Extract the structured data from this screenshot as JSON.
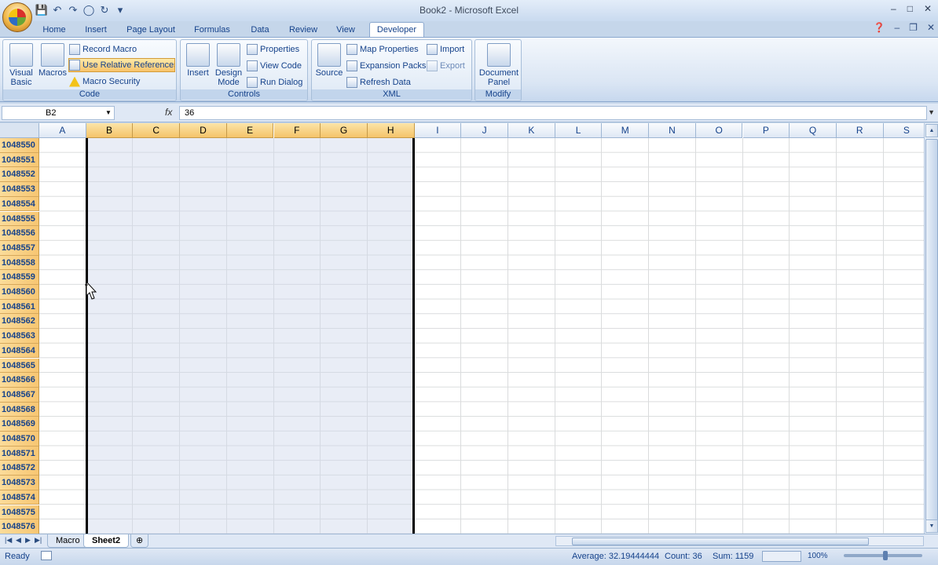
{
  "window": {
    "title": "Book2 - Microsoft Excel",
    "controls": [
      "–",
      "□",
      "✕"
    ]
  },
  "qat": {
    "icons": [
      "save-icon",
      "undo-icon",
      "redo-icon",
      "circle-icon",
      "loop-icon",
      "customize-icon"
    ]
  },
  "tabs": [
    {
      "label": "Home"
    },
    {
      "label": "Insert"
    },
    {
      "label": "Page Layout"
    },
    {
      "label": "Formulas"
    },
    {
      "label": "Data"
    },
    {
      "label": "Review"
    },
    {
      "label": "View"
    },
    {
      "label": "Developer"
    }
  ],
  "ribbon": {
    "code": {
      "label": "Code",
      "visual_basic": "Visual Basic",
      "macros": "Macros",
      "record_macro": "Record Macro",
      "use_relative": "Use Relative References",
      "macro_security": "Macro Security"
    },
    "controls": {
      "label": "Controls",
      "insert": "Insert",
      "design_mode": "Design Mode",
      "properties": "Properties",
      "view_code": "View Code",
      "run_dialog": "Run Dialog"
    },
    "xml": {
      "label": "XML",
      "source": "Source",
      "map_properties": "Map Properties",
      "expansion_packs": "Expansion Packs",
      "refresh_data": "Refresh Data",
      "import": "Import",
      "export": "Export"
    },
    "modify": {
      "label": "Modify",
      "document_panel": "Document Panel"
    }
  },
  "formula_bar": {
    "name_box": "B2",
    "fx": "fx",
    "value": "36"
  },
  "columns": [
    "A",
    "B",
    "C",
    "D",
    "E",
    "F",
    "G",
    "H",
    "I",
    "J",
    "K",
    "L",
    "M",
    "N",
    "O",
    "P",
    "Q",
    "R",
    "S"
  ],
  "selected_columns": [
    "B",
    "C",
    "D",
    "E",
    "F",
    "G",
    "H"
  ],
  "rows": [
    "1048550",
    "1048551",
    "1048552",
    "1048553",
    "1048554",
    "1048555",
    "1048556",
    "1048557",
    "1048558",
    "1048559",
    "1048560",
    "1048561",
    "1048562",
    "1048563",
    "1048564",
    "1048565",
    "1048566",
    "1048567",
    "1048568",
    "1048569",
    "1048570",
    "1048571",
    "1048572",
    "1048573",
    "1048574",
    "1048575",
    "1048576"
  ],
  "sheet_tabs": [
    {
      "label": "Macro",
      "active": false
    },
    {
      "label": "Sheet2",
      "active": true
    }
  ],
  "status": {
    "ready": "Ready",
    "average": "Average: 32.19444444",
    "count": "Count: 36",
    "sum": "Sum: 1159",
    "zoom": "100%"
  },
  "colors": {
    "ribbon_bg": "#dbe6f4",
    "row_header_selected": "#f7c672",
    "grid": "#dadcdd"
  }
}
